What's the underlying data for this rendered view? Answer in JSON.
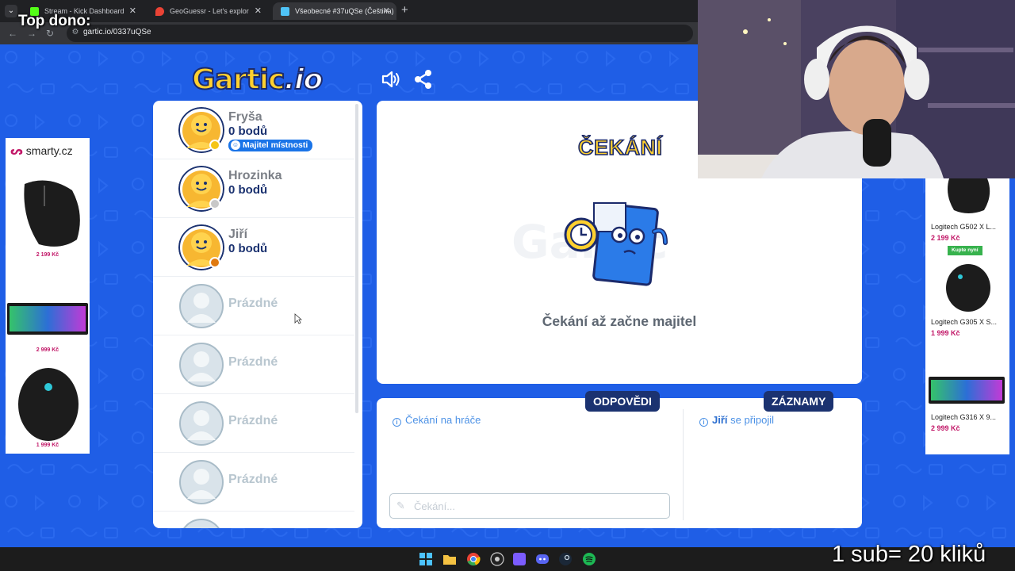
{
  "overlay": {
    "top_donor_label": "Top dono:",
    "sub_goal": "1 sub= 20 kliků"
  },
  "browser": {
    "tabs": [
      {
        "title": "Stream - Kick Dashboard",
        "favicon_color": "#53fc18",
        "active": false
      },
      {
        "title": "GeoGuessr - Let's explore the w...",
        "favicon_color": "#ea4335",
        "active": false
      },
      {
        "title": "Všeobecné #37uQSe (Čeština)",
        "favicon_color": "#4fc3f7",
        "active": true
      }
    ],
    "url": "gartic.io/0337uQSe"
  },
  "game": {
    "logo_main": "Gartic",
    "logo_suffix": ".io",
    "players": [
      {
        "name": "Fryša",
        "points": "0 bodů",
        "badge": "Majitel místnosti",
        "status_color": "#f5c518"
      },
      {
        "name": "Hrozinka",
        "points": "0 bodů",
        "status_color": "#c8c8c8"
      },
      {
        "name": "Jiří",
        "points": "0 bodů",
        "status_color": "#e07a10"
      }
    ],
    "empty_slots": [
      "Prázdné",
      "Prázdné",
      "Prázdné",
      "Prázdné"
    ],
    "waiting_title": "ČEKÁNÍ",
    "waiting_text": "Čekání až začne majitel",
    "chat": {
      "answers_tab": "ODPOVĚDI",
      "log_tab": "ZÁZNAMY",
      "answers_message": "Čekání na hráče",
      "log_message_user": "Jiří",
      "log_message_text": " se připojil",
      "input_placeholder": "Čekání..."
    }
  },
  "ads": {
    "left": {
      "brand": "smarty.cz",
      "prices": [
        "2 199 Kč",
        "2 999 Kč",
        "1 999 Kč"
      ]
    },
    "right": {
      "products": [
        {
          "name": "Logitech G502 X L...",
          "price": "2 199 Kč"
        },
        {
          "name": "Logitech G305 X S...",
          "price": "1 999 Kč"
        },
        {
          "name": "Logitech G316 X 9...",
          "price": "2 999 Kč"
        }
      ],
      "buy_label": "Kupte nyní"
    }
  },
  "colors": {
    "page_bg": "#1f5ee6",
    "navy": "#1b3270",
    "accent_blue": "#1a74e8",
    "yellow": "#ffd02f"
  }
}
